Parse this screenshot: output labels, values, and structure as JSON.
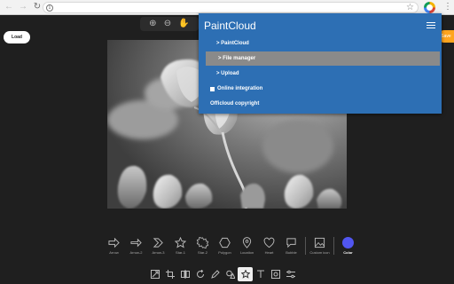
{
  "browser": {
    "url": ""
  },
  "app": {
    "load_label": "Load",
    "save_label": "Save"
  },
  "menu": {
    "title": "PaintCloud",
    "items": [
      {
        "label": "> PaintCloud"
      },
      {
        "label": "> File manager",
        "highlighted": true
      },
      {
        "label": "> Upload"
      },
      {
        "label": "Online integration"
      },
      {
        "label": "Officloud copyright"
      }
    ],
    "bg_color": "#2d6fb4",
    "highlight_color": "#8a8a8a"
  },
  "shapes": [
    {
      "label": "Arrow",
      "icon": "arrow-icon"
    },
    {
      "label": "Arrow-2",
      "icon": "arrow-2-icon"
    },
    {
      "label": "Arrow-3",
      "icon": "arrow-3-icon"
    },
    {
      "label": "Star-1",
      "icon": "star-1-icon"
    },
    {
      "label": "Star-2",
      "icon": "star-2-icon"
    },
    {
      "label": "Polygon",
      "icon": "polygon-icon"
    },
    {
      "label": "Location",
      "icon": "location-icon"
    },
    {
      "label": "Heart",
      "icon": "heart-icon"
    },
    {
      "label": "Bubble",
      "icon": "bubble-icon"
    },
    {
      "label": "Custom icon",
      "icon": "image-icon"
    },
    {
      "label": "Color",
      "icon": "color-swatch",
      "color": "#5156f0"
    }
  ],
  "tools": [
    "resize",
    "crop",
    "flip",
    "rotate",
    "draw",
    "shape",
    "icon",
    "text",
    "mask",
    "filter"
  ],
  "active_tool": "icon"
}
